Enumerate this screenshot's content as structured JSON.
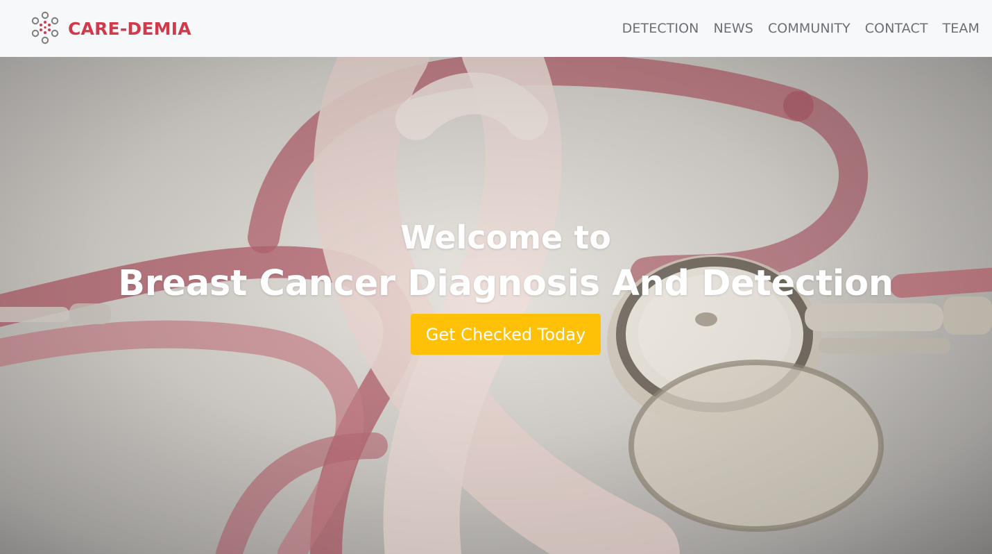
{
  "brand": {
    "name": "CARE-DEMIA",
    "logo_icon": "molecule-ring-icon",
    "color": "#d03a4a"
  },
  "nav": {
    "items": [
      {
        "label": "DETECTION"
      },
      {
        "label": "NEWS"
      },
      {
        "label": "COMMUNITY"
      },
      {
        "label": "CONTACT"
      },
      {
        "label": "TEAM"
      }
    ]
  },
  "hero": {
    "greeting": "Welcome to",
    "title": "Breast Cancer Diagnosis And Detection",
    "cta_label": "Get Checked Today",
    "cta_color": "#ffc107",
    "background": "pink awareness ribbon with stethoscope"
  }
}
